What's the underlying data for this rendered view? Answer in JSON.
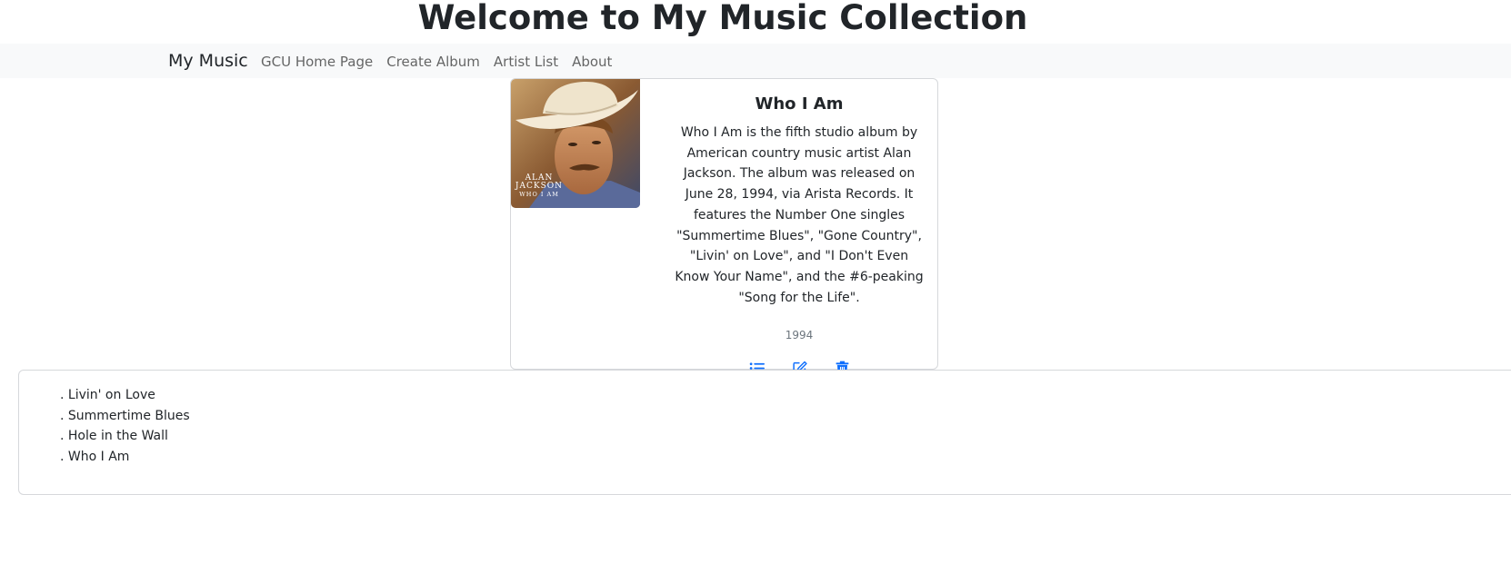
{
  "header": {
    "title": "Welcome to My Music Collection"
  },
  "navbar": {
    "brand": "My Music",
    "links": [
      {
        "label": "GCU Home Page"
      },
      {
        "label": "Create Album"
      },
      {
        "label": "Artist List"
      },
      {
        "label": "About"
      }
    ]
  },
  "album": {
    "cover_text": {
      "artist": "ALAN\nJACKSON",
      "album": "WHO I AM"
    },
    "title": "Who I Am",
    "description": "Who I Am is the fifth studio album by American country music artist Alan Jackson. The album was released on June 28, 1994, via Arista Records. It features the Number One singles \"Summertime Blues\", \"Gone Country\", \"Livin' on Love\", and \"I Don't Even Know Your Name\", and the #6-peaking \"Song for the Life\".",
    "year": "1994",
    "actions": [
      {
        "icon": "list-icon"
      },
      {
        "icon": "edit-icon"
      },
      {
        "icon": "trash-icon"
      }
    ],
    "accent_color": "#0d6efd"
  },
  "tracks": [
    ". Livin' on Love",
    ". Summertime Blues",
    ". Hole in the Wall",
    ". Who I Am"
  ]
}
